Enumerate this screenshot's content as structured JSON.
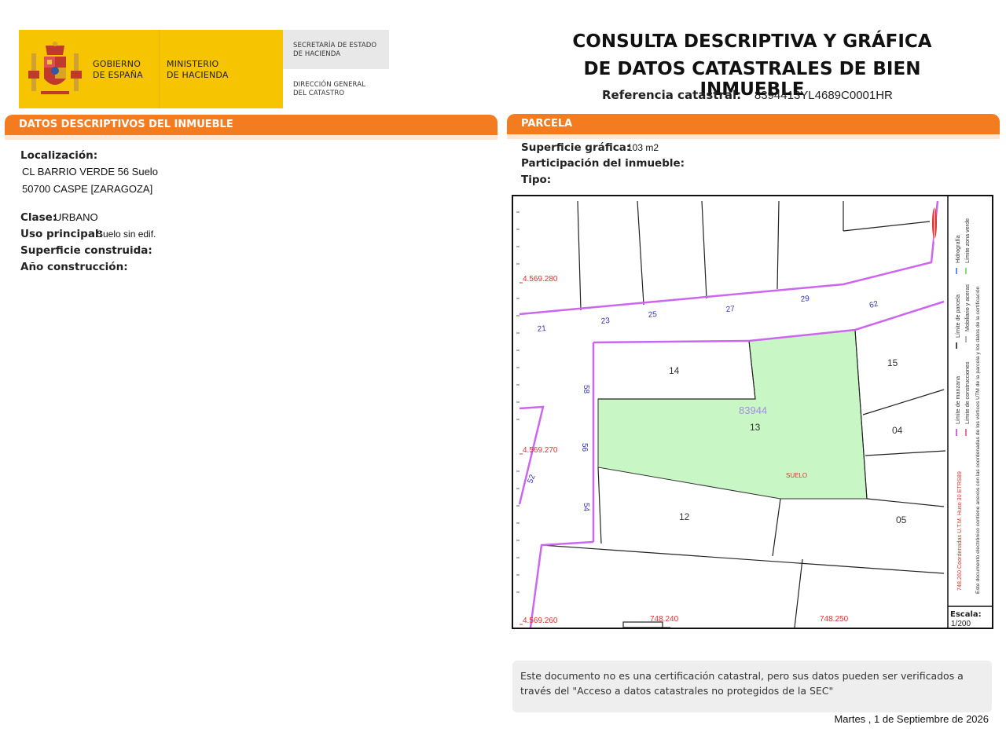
{
  "header": {
    "gov_line1": "GOBIERNO",
    "gov_line2": "DE ESPAÑA",
    "min_line1": "MINISTERIO",
    "min_line2": "DE HACIENDA",
    "sec_line1": "SECRETARÍA DE ESTADO",
    "sec_line2": "DE HACIENDA",
    "dir_line1": "DIRECCIÓN GENERAL",
    "dir_line2": "DEL CATASTRO",
    "title_line1": "CONSULTA DESCRIPTIVA Y GRÁFICA",
    "title_line2": "DE DATOS CATASTRALES DE BIEN INMUEBLE",
    "ref_label": "Referencia catastral:",
    "ref_value": "8394413YL4689C0001HR"
  },
  "descriptivos": {
    "section_title": "DATOS DESCRIPTIVOS DEL INMUEBLE",
    "localizacion_label": "Localización:",
    "address_line1": "CL BARRIO VERDE 56 Suelo",
    "address_line2": "50700 CASPE [ZARAGOZA]",
    "clase_label": "Clase:",
    "clase_value": "URBANO",
    "uso_label": "Uso principal:",
    "uso_value": "Suelo sin edif.",
    "superficie_label": "Superficie construida:",
    "anio_label": "Año construcción:"
  },
  "parcela": {
    "section_title": "PARCELA",
    "superficie_label": "Superficie gráfica:",
    "superficie_value": "103 m2",
    "participacion_label": "Participación del inmueble:",
    "tipo_label": "Tipo:"
  },
  "map": {
    "coords_y": [
      "4.569.280",
      "4.569.270",
      "4.569.260"
    ],
    "coords_x": [
      "748.240",
      "748.250"
    ],
    "parcel_numbers": [
      "14",
      "13",
      "12",
      "15",
      "04",
      "05"
    ],
    "street_numbers": [
      "21",
      "23",
      "25",
      "27",
      "29",
      "62",
      "58",
      "56",
      "54",
      "52"
    ],
    "block_label": "83944",
    "suelo_label": "SUELO",
    "legend_manzana": "Límite de manzana",
    "legend_parcela": "Límite de parcela",
    "legend_hidrografia": "Hidrografía",
    "legend_construcciones": "Límite de construcciones",
    "legend_mobiliario": "Mobiliario y aceras",
    "legend_zona_verde": "Límite zona verde",
    "coord_note": "748.260 Coordenadas U.T.M. Huso 30 ETRS89",
    "doc_note": "Este documento electrónico contiene anexos con las coordenadas de los vértices UTM de la parcela y los datos de la certificación",
    "escala_label": "Escala:",
    "escala_value": "1/200",
    "colors": {
      "parcel_fill": "#c8f7c5",
      "manzana": "#cc66ee",
      "coord_red": "#e03030",
      "street_num_blue": "#3333bb"
    }
  },
  "footer": {
    "notice": "Este documento no es una certificación catastral, pero sus datos pueden ser verificados a través del \"Acceso a datos catastrales no protegidos de la SEC\"",
    "date": "Martes , 1 de Septiembre de 2026"
  }
}
